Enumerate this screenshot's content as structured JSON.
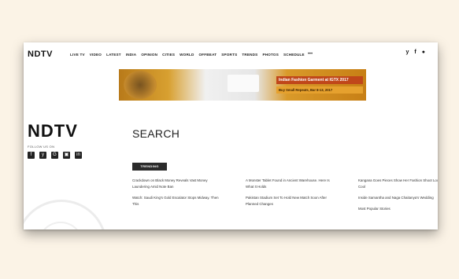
{
  "nav": {
    "logo": "NDTV",
    "items": [
      "LIVE TV",
      "VIDEO",
      "LATEST",
      "INDIA",
      "OPINION",
      "CITIES",
      "WORLD",
      "OFFBEAT",
      "SPORTS",
      "TRENDS",
      "PHOTOS",
      "SCHEDULE"
    ],
    "more": "•••",
    "social": [
      "y",
      "f",
      "●"
    ]
  },
  "banner": {
    "title": "Indian Fashion Garment at IGTX 2017",
    "subtitle": "Buy Small Repeats, Bar 8-13, 2017"
  },
  "sidebar": {
    "logo": "NDTV",
    "follow_label": "FOLLOW US ON",
    "social": [
      "f",
      "y",
      "G",
      "▣",
      "in"
    ]
  },
  "main": {
    "title": "SEARCH",
    "trending_label": "TRENDING",
    "stories": [
      [
        "Crackdown on Black Money Reveals Vast Money Laundering Amid Note Ban",
        "Watch: Saudi King's Gold Escalator Stops Midway. Then This"
      ],
      [
        "A Monster Tablet Found in Ancient Warehouse. Here Is What It Holds",
        "Pakistan Stadium Set To Hold New Match Soon After Planned Changes"
      ],
      [
        "Kangana Goes Pieces Show Her Fashion Shoot Look Cool",
        "Inside Samantha and Naga Chaitanya's Wedding"
      ]
    ],
    "col3_extra": "Most Popular Stories"
  }
}
